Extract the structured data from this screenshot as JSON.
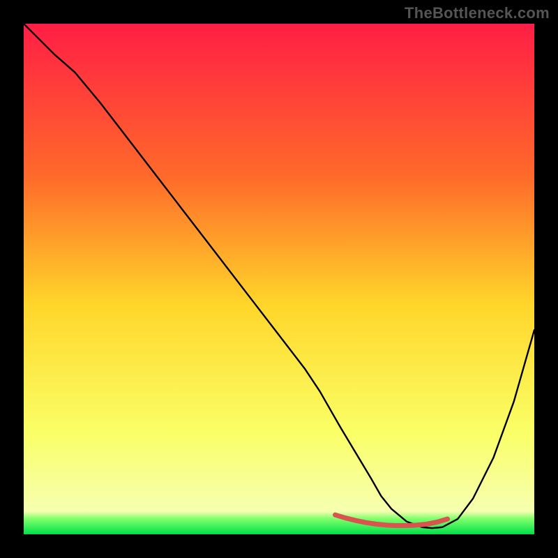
{
  "watermark": "TheBottleneck.com",
  "chart_data": {
    "type": "line",
    "title": "",
    "xlabel": "",
    "ylabel": "",
    "xlim": [
      0,
      100
    ],
    "ylim": [
      0,
      100
    ],
    "grid": false,
    "legend": false,
    "gradient_stops": [
      {
        "offset": 0,
        "color": "#ff1e45"
      },
      {
        "offset": 0.3,
        "color": "#ff6a2a"
      },
      {
        "offset": 0.55,
        "color": "#ffd62a"
      },
      {
        "offset": 0.8,
        "color": "#faff66"
      },
      {
        "offset": 0.955,
        "color": "#f6ffb0"
      },
      {
        "offset": 0.97,
        "color": "#7dff6a"
      },
      {
        "offset": 1.0,
        "color": "#00e04a"
      }
    ],
    "series": [
      {
        "name": "bottleneck-curve",
        "color": "#000000",
        "stroke_width": 2.4,
        "x": [
          0,
          3,
          6,
          10,
          15,
          20,
          25,
          30,
          35,
          40,
          45,
          50,
          55,
          58,
          60,
          62,
          65,
          68,
          70,
          72,
          75,
          78,
          80,
          82,
          85,
          88,
          92,
          96,
          100
        ],
        "y": [
          100,
          97,
          94,
          90.5,
          84.5,
          78,
          71.5,
          65,
          58.5,
          52,
          45.5,
          39,
          32.5,
          28,
          24.5,
          21,
          16,
          11,
          7.5,
          5,
          2.5,
          1.4,
          1.2,
          1.4,
          3,
          7,
          15,
          26,
          40
        ]
      },
      {
        "name": "optimal-band",
        "color": "#d9534f",
        "stroke_width": 7,
        "x": [
          61,
          63,
          65,
          67,
          69,
          71,
          73,
          75,
          77,
          79,
          81,
          83
        ],
        "y": [
          3.8,
          3.2,
          2.7,
          2.3,
          2.0,
          1.8,
          1.7,
          1.7,
          1.8,
          2.0,
          2.4,
          3.0
        ]
      }
    ]
  }
}
